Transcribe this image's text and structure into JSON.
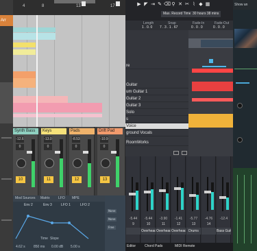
{
  "left": {
    "sidebar_label": "Arr",
    "ruler_ticks": [
      "4",
      "8",
      "13",
      "17"
    ],
    "channels": [
      {
        "name": "Synth Bass",
        "color": "#8fd0c0",
        "vol": "-12.6",
        "pan": "0",
        "num": "10",
        "level": 0.55
      },
      {
        "name": "Keys",
        "color": "#f5e17a",
        "vol": "-13.0",
        "pan": "0",
        "num": "11",
        "level": 0.6
      },
      {
        "name": "Pads",
        "color": "#f0b36b",
        "vol": "-8.53",
        "pan": "0",
        "num": "12",
        "level": 0.5
      },
      {
        "name": "Drift Pad",
        "color": "#f29a6c",
        "vol": "-10.9",
        "pan": "0",
        "num": "13",
        "level": 0.65
      }
    ],
    "device": {
      "tabs": [
        "Mod Sources",
        "Matrix",
        "LFO",
        "MPE"
      ],
      "sub": [
        "Env 2",
        "Env 3",
        "LFO 1",
        "LFO 2"
      ],
      "time_label": "Time",
      "slope_label": "Slope",
      "values": [
        "4.62 s",
        "850 ms",
        "0.00 dB",
        "5.00 s"
      ],
      "buttons": [
        "None",
        "None",
        "Free"
      ]
    }
  },
  "mid": {
    "toolbar_buttons": [
      "Max. Record Time",
      "30 hours 38 mins"
    ],
    "info_labels": [
      "Length",
      "Snap",
      "Fade-In",
      "Fade-Out"
    ],
    "info_values": [
      "1 . 0. 0",
      "7 . 3 . 1 . 67",
      "0 . 0 . 0",
      "0 . 0 . 0"
    ],
    "tracks": [
      "re",
      "Guitar",
      "um Guitar 1",
      "Guitar 2",
      "Guitar 3",
      "Solo",
      "s",
      "Voice",
      "ground Vocals",
      "",
      "RoomWorks"
    ],
    "selected_track_index": 7,
    "strips": [
      {
        "val": "-5.44",
        "num": "9",
        "name": "",
        "level": 0.7,
        "cap": 0.45
      },
      {
        "val": "-5.44",
        "num": "10",
        "name": "Overhead L",
        "level": 0.75,
        "cap": 0.4
      },
      {
        "val": "-3.90",
        "num": "11",
        "name": "Overhead R",
        "level": 0.6,
        "cap": 0.35
      },
      {
        "val": "-1.41",
        "num": "12",
        "name": "Overheads",
        "level": 0.8,
        "cap": 0.3
      },
      {
        "val": "-5.77",
        "num": "13",
        "name": "Drums",
        "level": 0.55,
        "cap": 0.5
      },
      {
        "val": "-4.76",
        "num": "14",
        "name": "",
        "level": 0.65,
        "cap": 0.4
      },
      {
        "val": "-12.4",
        "num": "",
        "name": "Bass Guitar",
        "level": 0.45,
        "cap": 0.55
      }
    ],
    "bottom_tabs": [
      "Editor",
      "Chord Pads",
      "MIDI Remote"
    ]
  },
  "right": {
    "top_label": "Show an"
  }
}
